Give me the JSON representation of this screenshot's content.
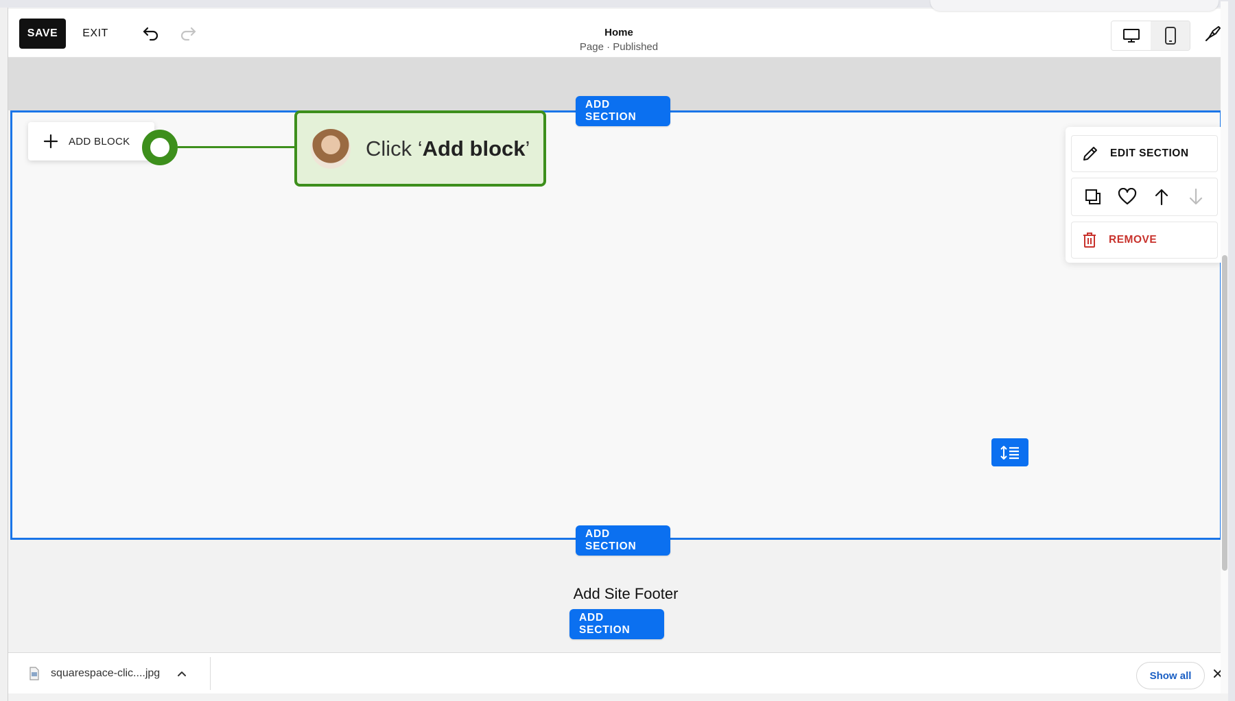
{
  "toolbar": {
    "save_label": "SAVE",
    "exit_label": "EXIT",
    "title": "Home",
    "subtitle": "Page · Published",
    "icons": [
      "undo-icon",
      "redo-icon",
      "desktop-icon",
      "mobile-icon",
      "paintbrush-icon"
    ]
  },
  "canvas": {
    "add_section_label": "ADD SECTION",
    "add_block_label": "ADD BLOCK",
    "footer_title": "Add Site Footer"
  },
  "callout": {
    "prefix": "Click ‘",
    "bold": "Add block",
    "suffix": "’"
  },
  "section_panel": {
    "edit_label": "EDIT SECTION",
    "remove_label": "REMOVE",
    "remove_color": "#c8322c"
  },
  "download_bar": {
    "file_name": "squarespace-clic....jpg",
    "show_all_label": "Show all"
  },
  "colors": {
    "accent": "#0b70f0",
    "callout_green": "#3d8f1c",
    "callout_bg": "#e4f1d8"
  }
}
